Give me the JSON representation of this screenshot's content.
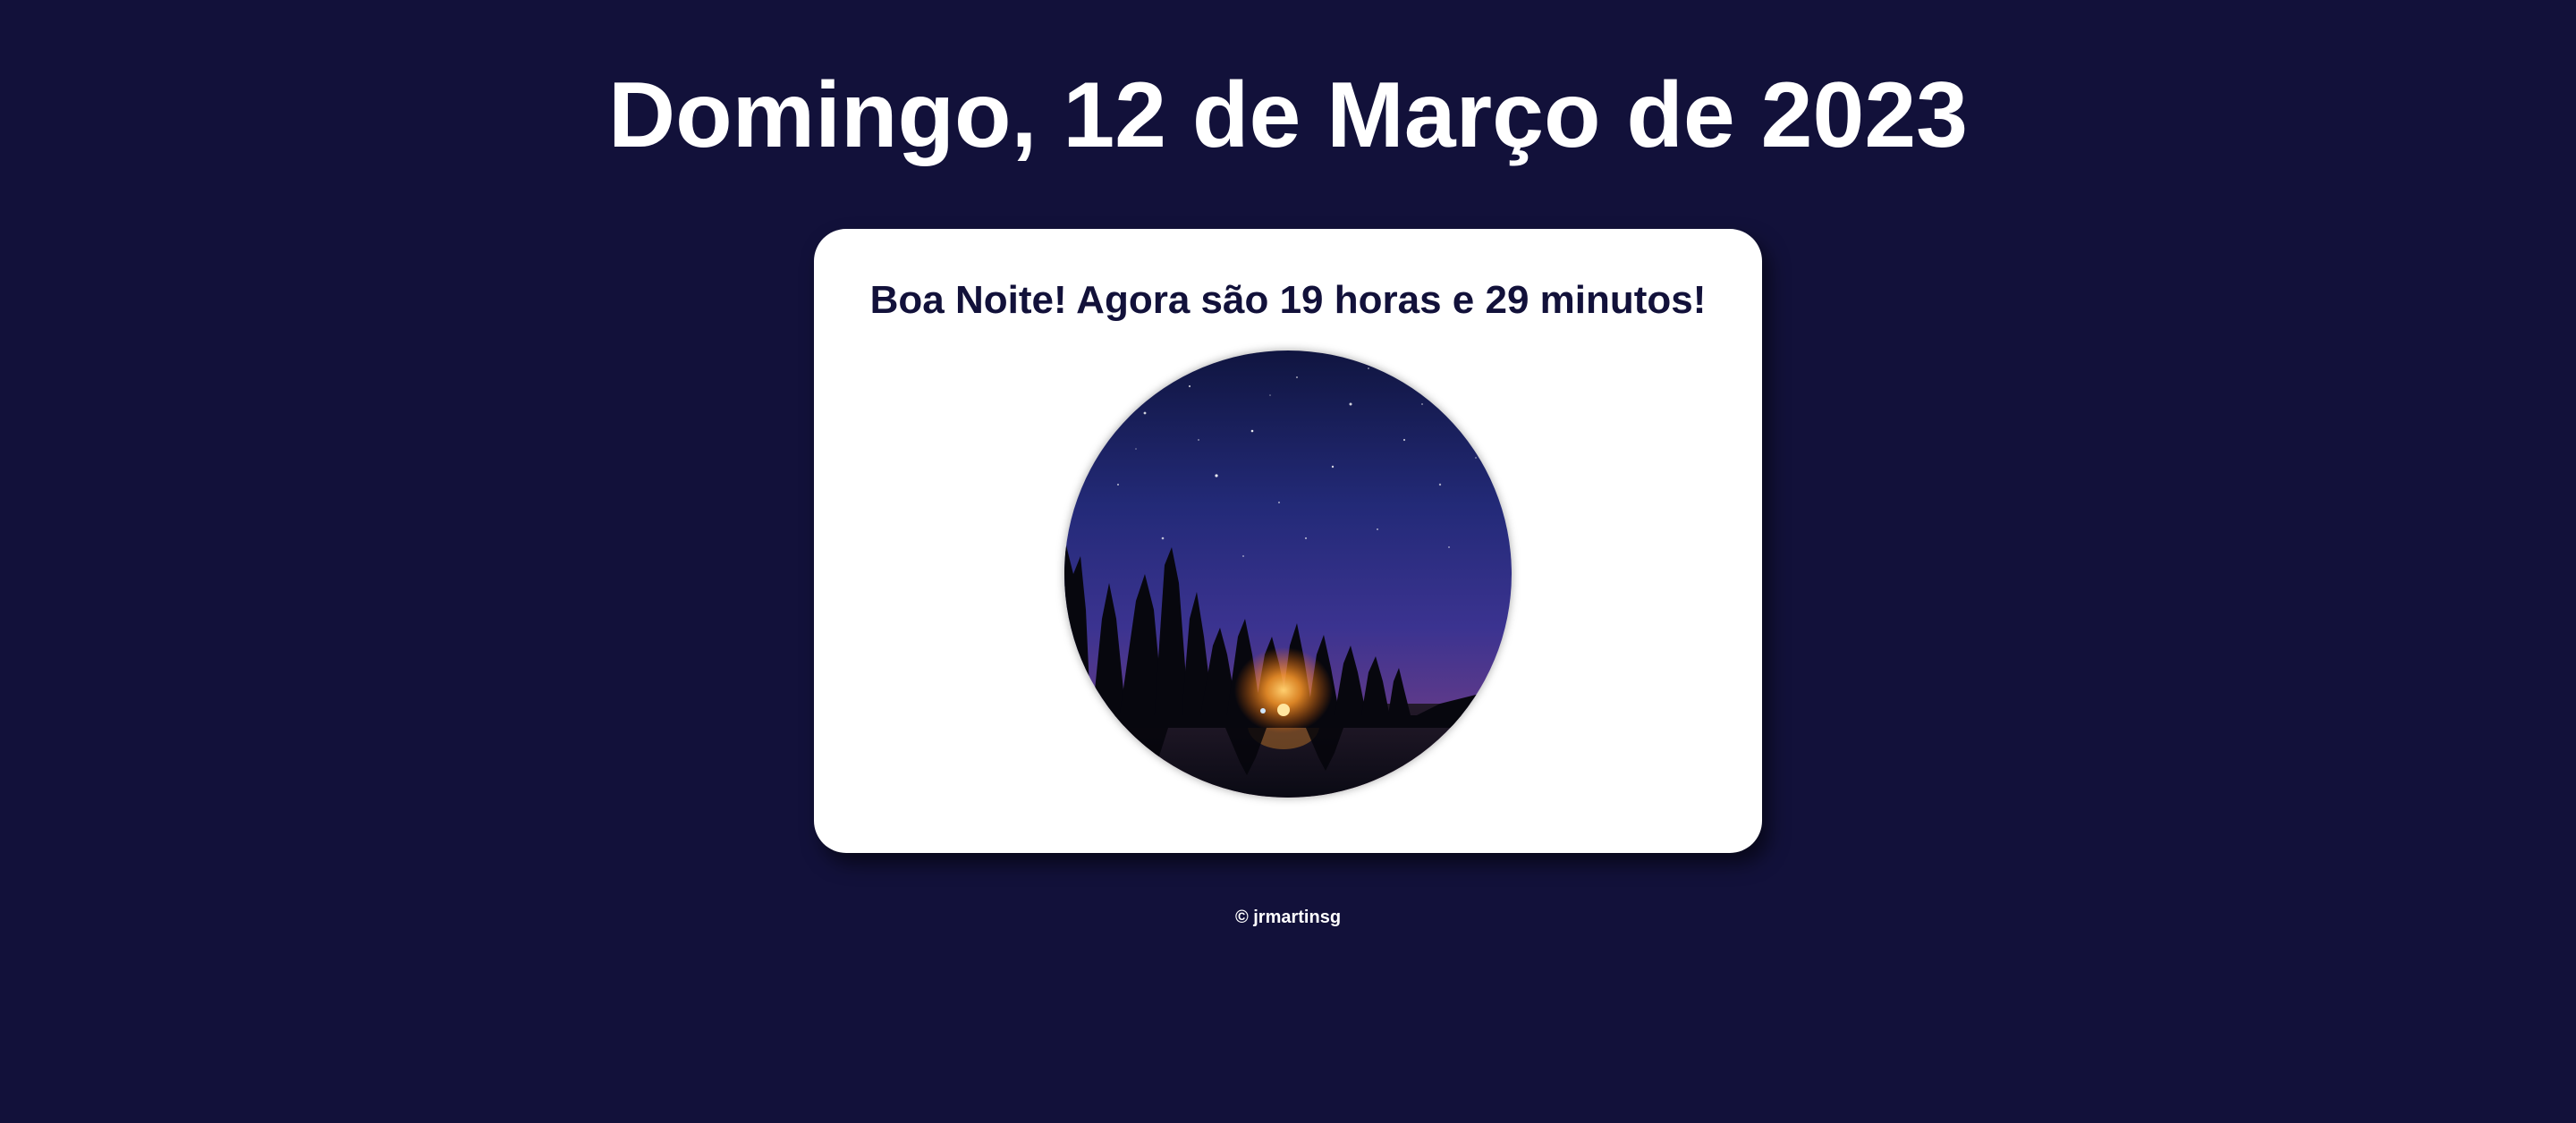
{
  "header": {
    "date_text": "Domingo, 12 de Março de 2023"
  },
  "card": {
    "greeting_text": "Boa Noite! Agora são 19 horas e 29 minutos!",
    "image_subject": "night-sky-campfire-forest-lake"
  },
  "footer": {
    "copyright_text": "© jrmartinsg"
  },
  "colors": {
    "background": "#12113a",
    "card": "#ffffff",
    "heading_text": "#ffffff",
    "greeting_text": "#12113a"
  }
}
